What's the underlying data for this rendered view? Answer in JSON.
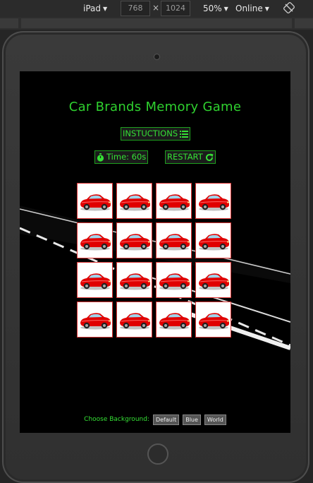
{
  "devtools": {
    "device": "iPad",
    "width": "768",
    "height": "1024",
    "times": "×",
    "zoom": "50%",
    "network": "Online"
  },
  "game": {
    "title": "Car Brands Memory Game",
    "instructions_label": "INSTUCTIONS",
    "timer_label": "Time: 60s",
    "restart_label": "RESTART",
    "card_count": 16,
    "background_label": "Choose Background:",
    "backgrounds": [
      "Default",
      "Blue",
      "World"
    ]
  },
  "colors": {
    "accent": "#35e035",
    "card_back_car": "#e00000"
  }
}
